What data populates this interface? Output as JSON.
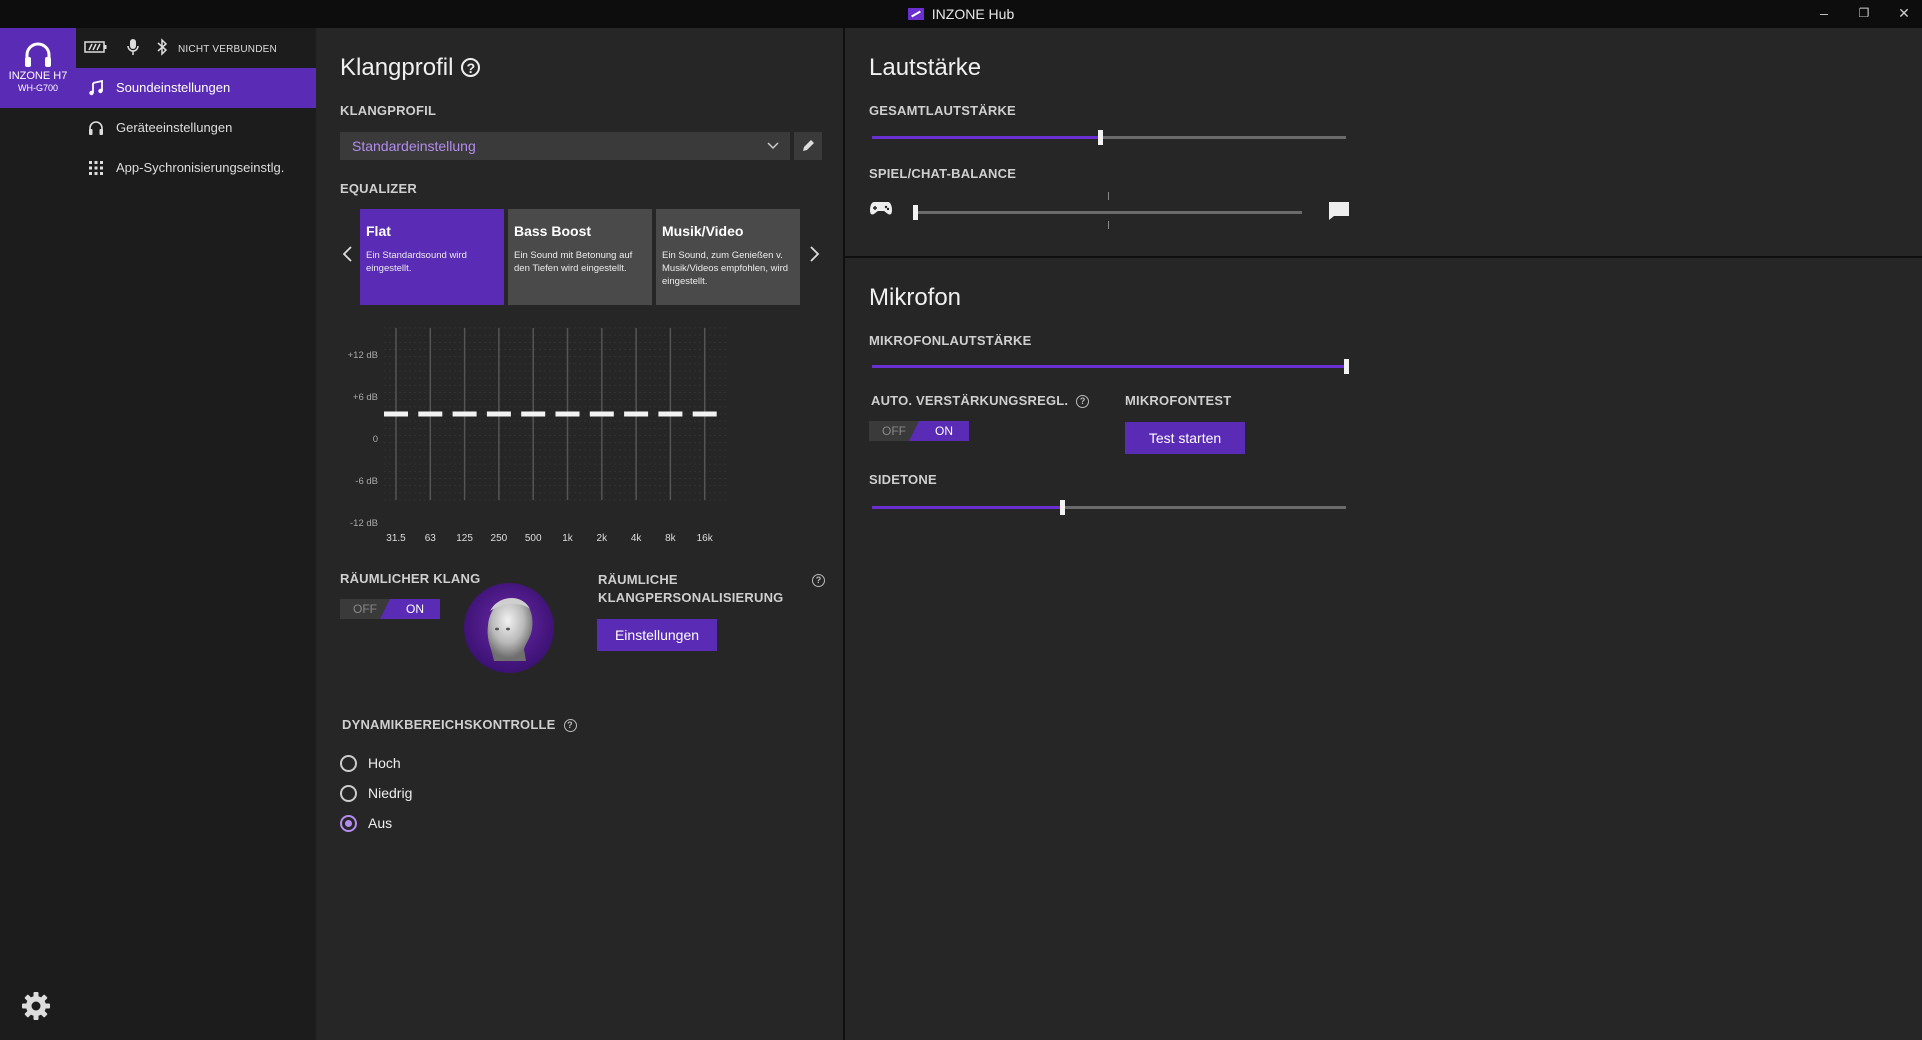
{
  "window": {
    "title": "INZONE Hub",
    "minimize": "–",
    "restore": "❐",
    "close": "✕"
  },
  "device": {
    "name": "INZONE H7",
    "model": "WH-G700",
    "connection_status": "NICHT VERBUNDEN"
  },
  "nav": {
    "items": [
      {
        "label": "Soundeinstellungen",
        "icon": "music-note-icon",
        "active": true
      },
      {
        "label": "Geräteeinstellungen",
        "icon": "headphones-icon",
        "active": false
      },
      {
        "label": "App-Sychronisierungseinstlg.",
        "icon": "grid-icon",
        "active": false
      }
    ]
  },
  "sound": {
    "title": "Klangprofil",
    "profile_label": "KLANGPROFIL",
    "profile_value": "Standardeinstellung",
    "equalizer_label": "EQUALIZER",
    "presets": [
      {
        "name": "Flat",
        "desc": "Ein Standardsound wird eingestellt.",
        "active": true
      },
      {
        "name": "Bass Boost",
        "desc": "Ein Sound mit Betonung auf den Tiefen wird eingestellt.",
        "active": false
      },
      {
        "name": "Musik/Video",
        "desc": "Ein Sound, zum Genießen v. Musik/Videos empfohlen, wird eingestellt.",
        "active": false
      }
    ],
    "eq_db_labels": [
      "+12 dB",
      "+6 dB",
      "0",
      "-6 dB",
      "-12 dB"
    ],
    "eq_bands": [
      "31.5",
      "63",
      "125",
      "250",
      "500",
      "1k",
      "2k",
      "4k",
      "8k",
      "16k"
    ],
    "eq_values_db": [
      0,
      0,
      0,
      0,
      0,
      0,
      0,
      0,
      0,
      0
    ],
    "spatial_label": "RÄUMLICHER KLANG",
    "spatial_off": "OFF",
    "spatial_on": "ON",
    "spatial_personal_label_1": "RÄUMLICHE",
    "spatial_personal_label_2": "KLANGPERSONALISIERUNG",
    "settings_button": "Einstellungen",
    "drc_label": "DYNAMIKBEREICHSKONTROLLE",
    "drc_options": [
      "Hoch",
      "Niedrig",
      "Aus"
    ],
    "drc_selected": "Aus"
  },
  "volume": {
    "title": "Lautstärke",
    "master_label": "GESAMTLAUTSTÄRKE",
    "master_value": 0.48,
    "balance_label": "SPIEL/CHAT-BALANCE",
    "balance_value": 0.0
  },
  "mic": {
    "title": "Mikrofon",
    "volume_label": "MIKROFONLAUTSTÄRKE",
    "volume_value": 1.0,
    "agc_label": "AUTO. VERSTÄRKUNGSREGL.",
    "agc_off": "OFF",
    "agc_on": "ON",
    "test_label": "MIKROFONTEST",
    "test_button": "Test starten",
    "sidetone_label": "SIDETONE",
    "sidetone_value": 0.4
  },
  "colors": {
    "accent": "#5a2bb5",
    "accent_light": "#b48cf0",
    "panel": "#262626",
    "sidebar": "#1c1c1c"
  }
}
